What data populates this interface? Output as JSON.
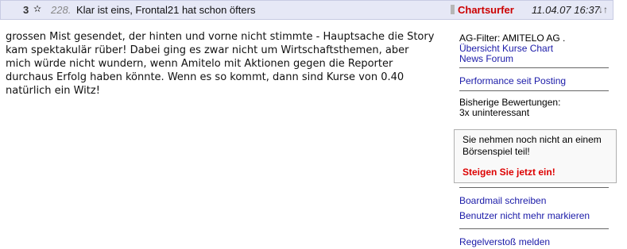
{
  "header": {
    "number": "3",
    "post_number": "228.",
    "title": "Klar ist eins, Frontal21 hat schon öfters",
    "author": "Chartsurfer",
    "datetime": "11.04.07 16:37",
    "arrows": "↓↑"
  },
  "post": {
    "text": "grossen Mist gesendet, der hinten und vorne nicht stimmte - Hauptsache die Story kam spektakulär rüber! Dabei ging es zwar nicht um Wirtschaftsthemen, aber mich würde nicht wundern, wenn Amitelo mit Aktionen gegen die Reporter durchaus Erfolg haben könnte. Wenn es so kommt, dann sind Kurse von 0.40 natürlich ein Witz!"
  },
  "sidebar": {
    "filter": "AG-Filter: AMITELO AG .",
    "overview_link": "Übersicht Kurse Chart",
    "news_link": "News Forum",
    "performance_link": "Performance seit Posting",
    "ratings_label": "Bisherige Bewertungen:",
    "ratings_value": "3x uninteressant",
    "game_message": "Sie nehmen noch nicht an einem Börsenspiel teil!",
    "game_cta": "Steigen Sie jetzt ein!",
    "boardmail_link": "Boardmail schreiben",
    "unmark_link": "Benutzer nicht mehr markieren",
    "report_link": "Regelverstoß melden"
  },
  "colors": {
    "header_bg": "#e6e8f6",
    "author": "#cc0000",
    "link": "#1a1aa8",
    "cta": "#dd0000"
  },
  "icons": [
    "star-rating-icon",
    "user-status-icon",
    "sort-arrows-icon"
  ]
}
